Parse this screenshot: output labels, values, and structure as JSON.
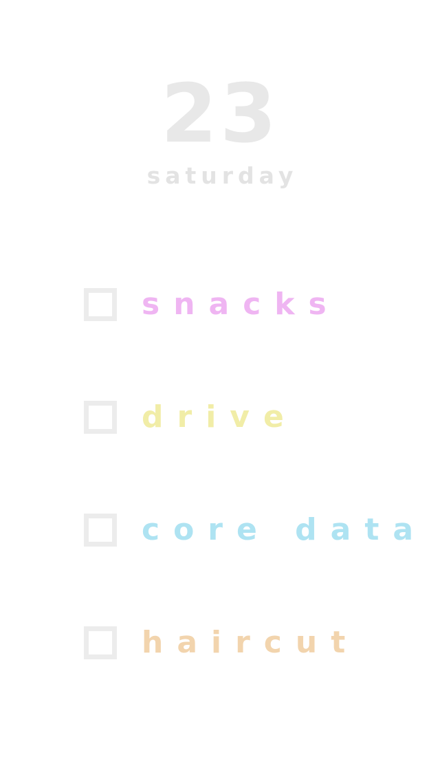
{
  "date": {
    "day": "23",
    "weekday": "saturday"
  },
  "tasks": [
    {
      "label": "snacks",
      "color": "#efb5f2",
      "checked": false
    },
    {
      "label": "drive",
      "color": "#f1eda7",
      "checked": false
    },
    {
      "label": "core data",
      "color": "#aee3f2",
      "checked": false
    },
    {
      "label": "haircut",
      "color": "#f2d4ad",
      "checked": false
    }
  ]
}
